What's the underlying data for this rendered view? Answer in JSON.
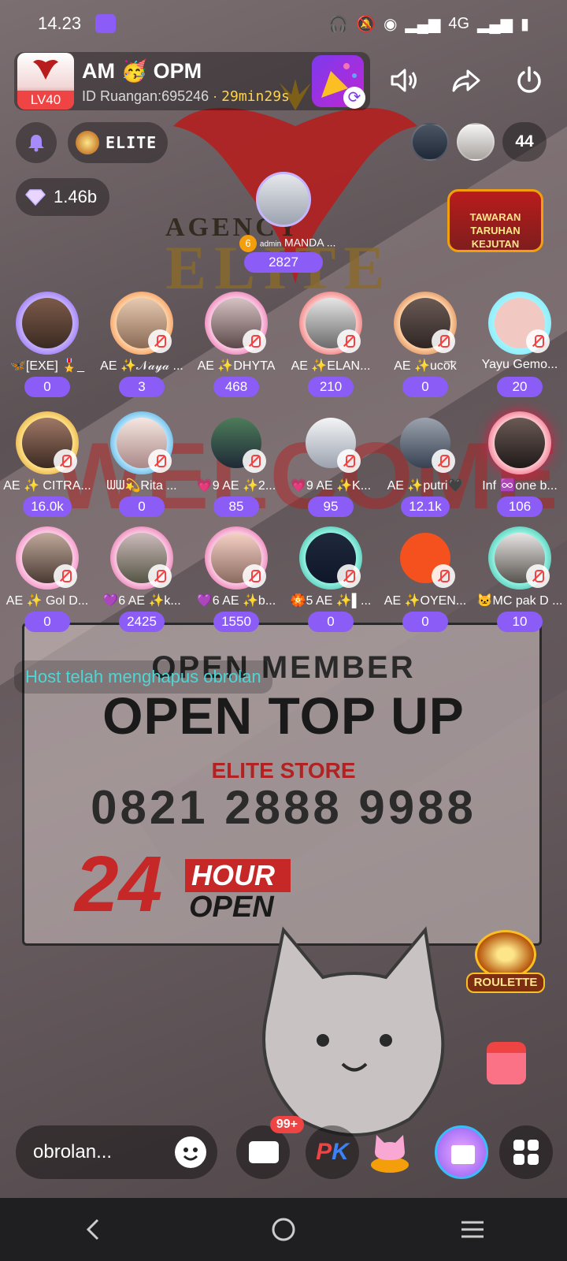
{
  "status_bar": {
    "time": "14.23",
    "network": "4G"
  },
  "room": {
    "name": "AM 🥳       OPM",
    "level": "LV40",
    "id_label": "ID Ruangan:695246",
    "separator": "·",
    "timer": "29min29s"
  },
  "badges": {
    "elite": "ELITE",
    "diamonds": "1.46b",
    "viewer_count": "44"
  },
  "promo": {
    "text": "TAWARAN TARUHAN KEJUTAN"
  },
  "host": {
    "level": "6",
    "tag": "admin",
    "name": "MANDA ...",
    "score": "2827"
  },
  "seats": [
    [
      {
        "label": "🦋[EXE] 🎖️_",
        "score": "0"
      },
      {
        "label": "AE ✨𝒩𝒶𝓎𝒶 ...",
        "score": "3"
      },
      {
        "label": "AE ✨DHYTA",
        "score": "468"
      },
      {
        "label": "AE ✨ELAN...",
        "score": "210"
      },
      {
        "label": "AE ✨uco͞k",
        "score": "0"
      },
      {
        "label": "Yayu Gemo...",
        "score": "20"
      }
    ],
    [
      {
        "label": "AE ✨ CITRA...",
        "score": "16.0k"
      },
      {
        "label": "ᗯᗯ💫Rita ...",
        "score": "0"
      },
      {
        "label": "💗9 AE ✨2...",
        "score": "85"
      },
      {
        "label": "💗9 AE ✨K...",
        "score": "95"
      },
      {
        "label": "AE ✨putri🖤",
        "score": "12.1k"
      },
      {
        "label": "Inf ♾️one b...",
        "score": "106"
      }
    ],
    [
      {
        "label": "AE ✨ Gol D...",
        "score": "0"
      },
      {
        "label": "💜6 AE ✨k...",
        "score": "2425"
      },
      {
        "label": "💜6 AE ✨b...",
        "score": "1550"
      },
      {
        "label": "🏵️5 AE ✨▌...",
        "score": "0"
      },
      {
        "label": "AE ✨OYEN...",
        "score": "0"
      },
      {
        "label": "🐱MC pak D ...",
        "score": "10"
      }
    ]
  ],
  "chat": {
    "system_message": "Host telah menghapus obrolan"
  },
  "poster": {
    "agency": "AGENCY",
    "elite": "ELITE",
    "welcome": "WELCOME",
    "open_member": "OPEN  MEMBER",
    "open_top_up": "OPEN TOP UP",
    "store": "ELITE STORE",
    "phone": "0821 2888 9988",
    "hours": "24",
    "hour_label": "HOUR",
    "open_label": "OPEN"
  },
  "roulette": {
    "label": "ROULETTE"
  },
  "bottom": {
    "chat_placeholder": "obrolan...",
    "message_badge": "99+",
    "pk_p": "P",
    "pk_k": "K"
  },
  "colors": {
    "accent": "#8b5cf6",
    "system_text": "#4dd6d6",
    "muted_red": "#ef4444"
  }
}
